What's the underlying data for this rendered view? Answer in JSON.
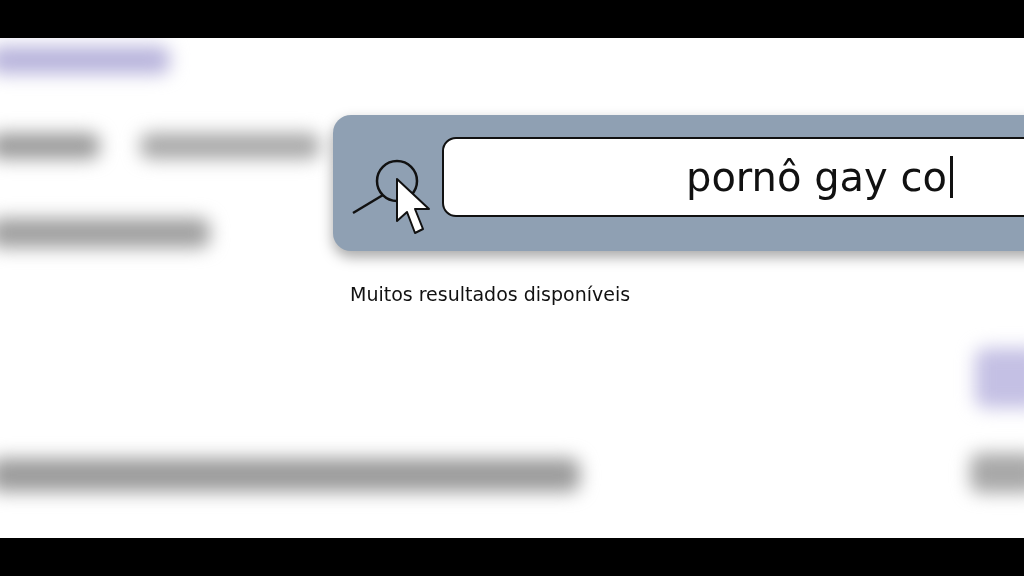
{
  "search": {
    "value": "pornô gay co",
    "caption": "Muitos resultados disponíveis"
  }
}
